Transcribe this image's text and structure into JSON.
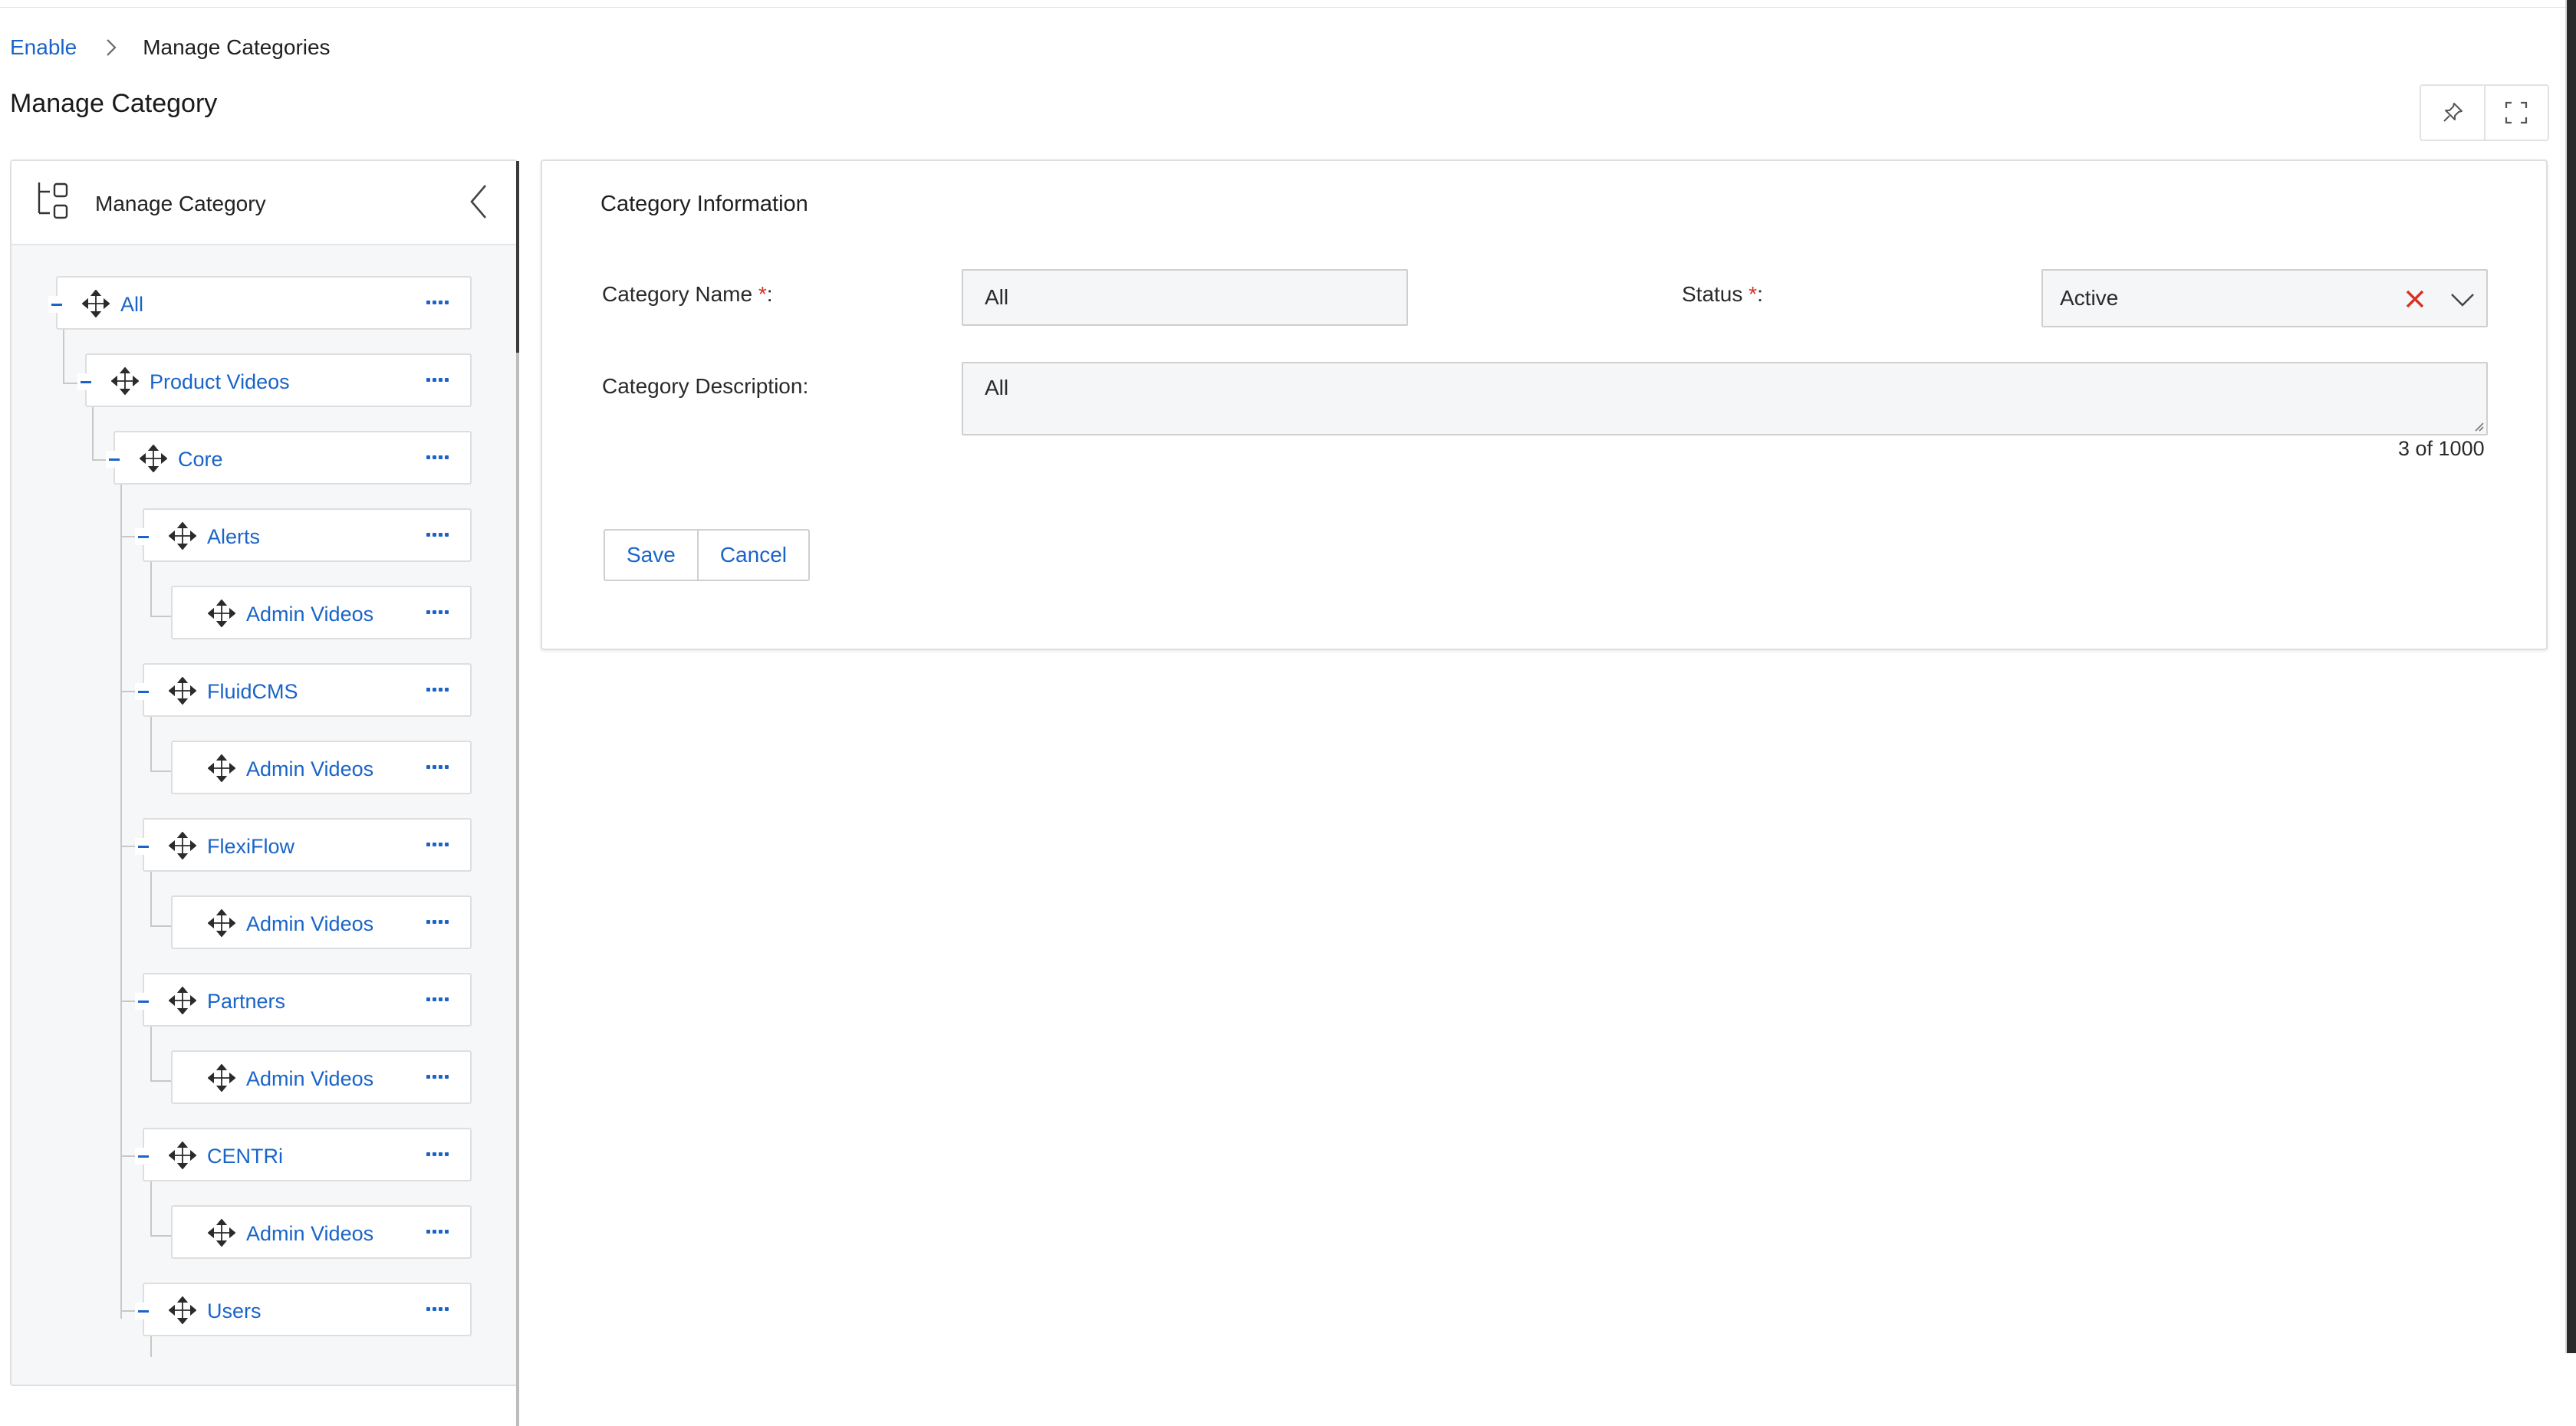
{
  "breadcrumb": {
    "root": "Enable",
    "current": "Manage Categories"
  },
  "page": {
    "title": "Manage Category"
  },
  "toolbar": {
    "pin_icon": "pin-icon",
    "fullscreen_icon": "fullscreen-icon"
  },
  "tree_panel": {
    "title": "Manage Category",
    "nodes": [
      {
        "label": "All"
      },
      {
        "label": "Product Videos"
      },
      {
        "label": "Core"
      },
      {
        "label": "Alerts"
      },
      {
        "label": "Admin Videos"
      },
      {
        "label": "FluidCMS"
      },
      {
        "label": "Admin Videos"
      },
      {
        "label": "FlexiFlow"
      },
      {
        "label": "Admin Videos"
      },
      {
        "label": "Partners"
      },
      {
        "label": "Admin Videos"
      },
      {
        "label": "CENTRi"
      },
      {
        "label": "Admin Videos"
      },
      {
        "label": "Users"
      }
    ]
  },
  "form": {
    "title": "Category Information",
    "name_label": "Category Name ",
    "required_mark": "*",
    "colon": ":",
    "name_value": "All",
    "status_label": "Status ",
    "status_value": "Active",
    "description_label": "Category Description:",
    "description_value": "All",
    "counter": "3 of 1000",
    "save_label": "Save",
    "cancel_label": "Cancel"
  },
  "colors": {
    "link": "#1a64c8",
    "clear": "#d93025",
    "panel_bg": "#f6f7f8",
    "field_bg": "#f5f6f7"
  }
}
